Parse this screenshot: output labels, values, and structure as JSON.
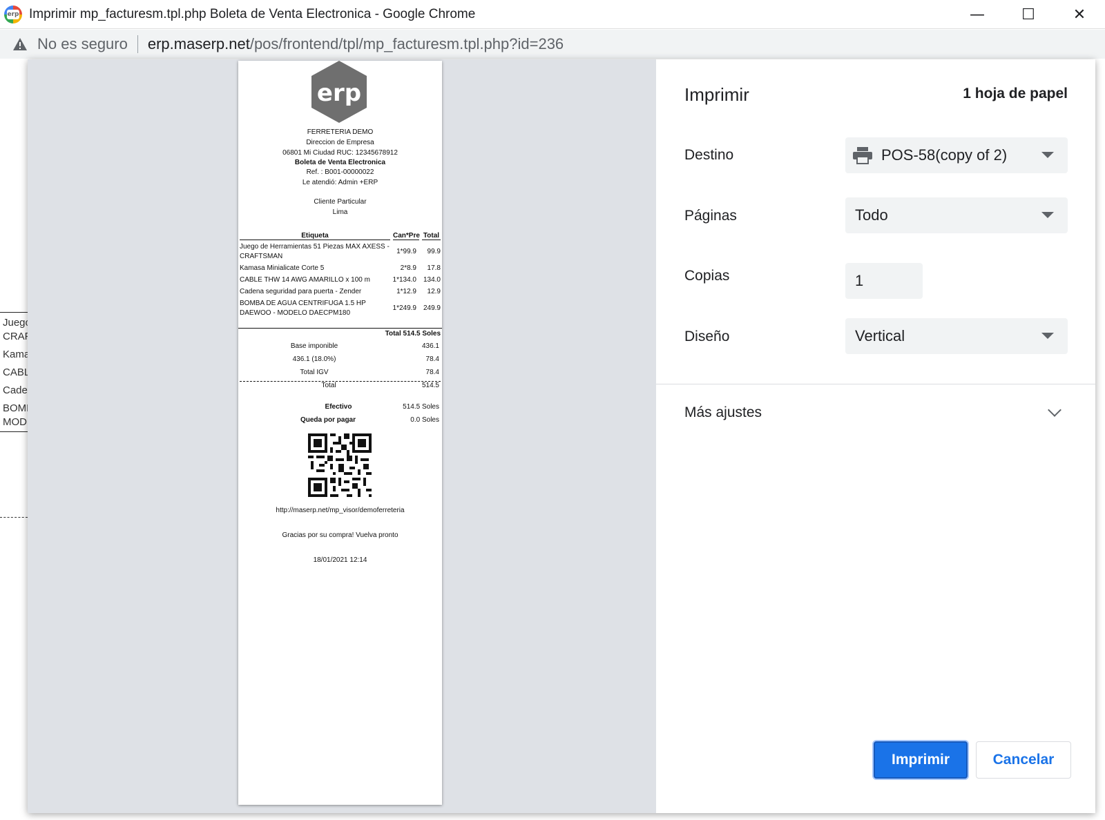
{
  "window": {
    "title": "Imprimir mp_facturesm.tpl.php Boleta de Venta Electronica - Google Chrome",
    "minimize": "—",
    "maximize": "☐",
    "close": "✕"
  },
  "address_bar": {
    "security_label": "No es seguro",
    "url_host": "erp.maserp.net",
    "url_path": "/pos/frontend/tpl/mp_facturesm.tpl.php?id=236"
  },
  "background_page": {
    "fragments": [
      "Juego",
      "CRAF",
      "Kama",
      "CABL",
      "Caden",
      "BOMB",
      "MODE"
    ]
  },
  "receipt": {
    "logo_text": "erp",
    "company": "FERRETERIA DEMO",
    "address": "Direccion de Empresa",
    "city_ruc": "06801 Mi Ciudad RUC: 12345678912",
    "doc_type": "Boleta de Venta Electronica",
    "ref": "Ref. : B001-00000022",
    "attended": "Le atendió: Admin +ERP",
    "client": "Cliente Particular",
    "client_city": "Lima",
    "headers": [
      "Etiqueta",
      "Can*Pre",
      "Total"
    ],
    "items": [
      {
        "label": "Juego de Herramientas 51 Piezas MAX AXESS - CRAFTSMAN",
        "qty_price": "1*99.9",
        "total": "99.9"
      },
      {
        "label": "Kamasa Minialicate Corte 5",
        "qty_price": "2*8.9",
        "total": "17.8"
      },
      {
        "label": "CABLE THW 14 AWG AMARILLO x 100 m",
        "qty_price": "1*134.0",
        "total": "134.0"
      },
      {
        "label": "Cadena seguridad para puerta - Zender",
        "qty_price": "1*12.9",
        "total": "12.9"
      },
      {
        "label": "BOMBA DE AGUA CENTRIFUGA 1.5 HP DAEWOO - MODELO DAECPM180",
        "qty_price": "1*249.9",
        "total": "249.9"
      }
    ],
    "total_line": "Total 514.5 Soles",
    "base_label": "Base imponible",
    "base_value": "436.1",
    "tax_label": "436.1 (18.0%)",
    "tax_value": "78.4",
    "igv_label": "Total IGV",
    "igv_value": "78.4",
    "grand_label": "Total",
    "grand_value": "514.5",
    "cash_label": "Efectivo",
    "cash_value": "514.5 Soles",
    "due_label": "Queda por pagar",
    "due_value": "0.0 Soles",
    "url": "http://maserp.net/mp_visor/demoferreteria",
    "thanks": "Gracias por su compra! Vuelva pronto",
    "datetime": "18/01/2021 12:14"
  },
  "settings": {
    "title": "Imprimir",
    "sheets": "1 hoja de papel",
    "destination_label": "Destino",
    "destination_value": "POS-58(copy of 2)",
    "pages_label": "Páginas",
    "pages_value": "Todo",
    "copies_label": "Copias",
    "copies_value": "1",
    "layout_label": "Diseño",
    "layout_value": "Vertical",
    "more_settings": "Más ajustes",
    "print_button": "Imprimir",
    "cancel_button": "Cancelar"
  },
  "colors": {
    "accent": "#1a73e8",
    "preview_bg": "#dee1e6",
    "field_bg": "#f1f3f4"
  }
}
